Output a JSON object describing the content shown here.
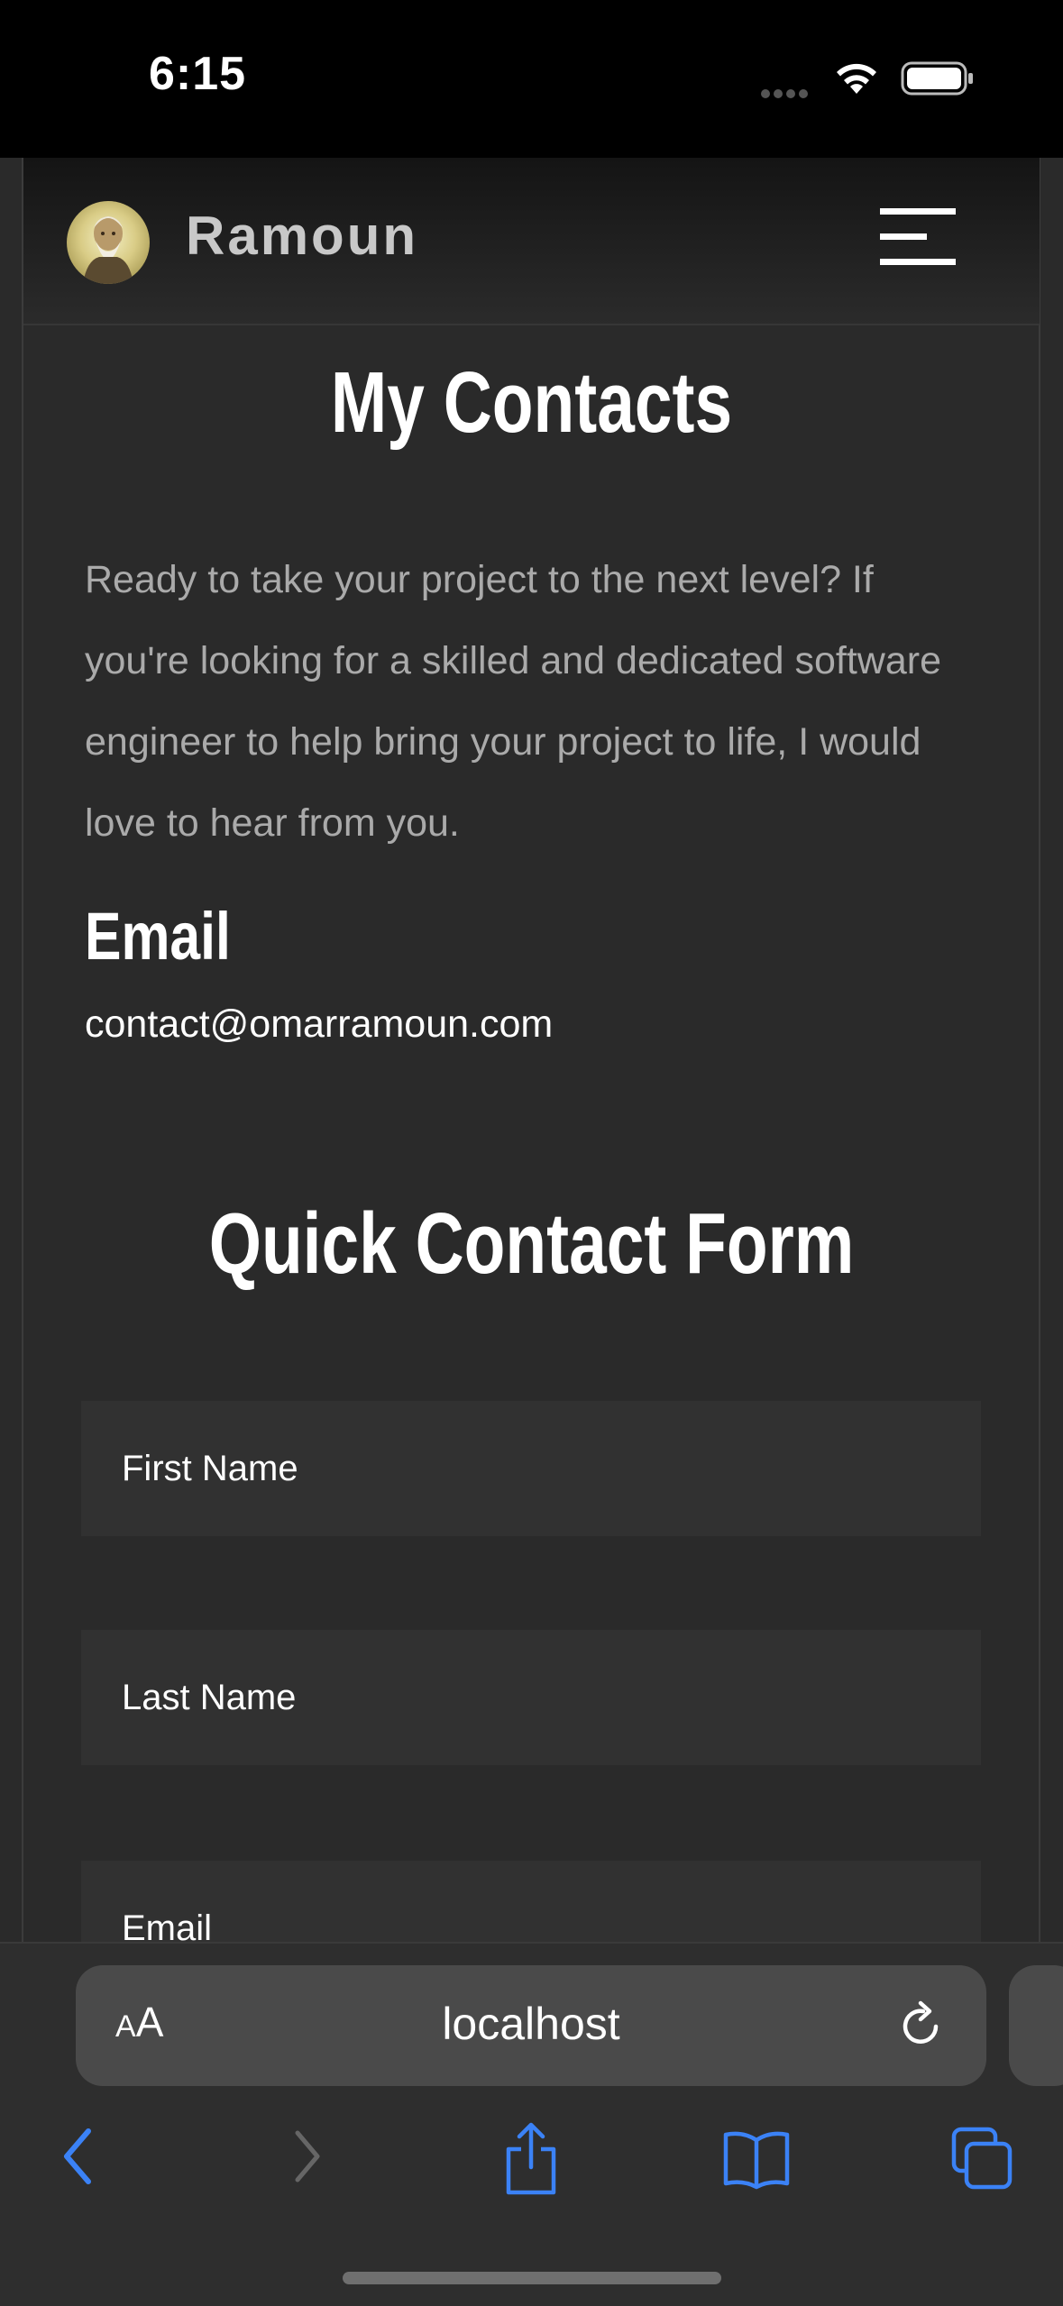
{
  "status_bar": {
    "time": "6:15"
  },
  "header": {
    "brand": "Ramoun"
  },
  "contacts": {
    "title": "My Contacts",
    "intro": "Ready to take your project to the next level? If you're looking for a skilled and dedicated software engineer to help bring your project to life, I would love to hear from you.",
    "email_heading": "Email",
    "email_value": "contact@omarramoun.com"
  },
  "form": {
    "title": "Quick Contact Form",
    "first_name_placeholder": "First Name",
    "last_name_placeholder": "Last Name",
    "email_placeholder": "Email"
  },
  "browser": {
    "text_size_small": "A",
    "text_size_big": "A",
    "url": "localhost",
    "accent_color": "#3b82f6"
  },
  "icons": [
    "wifi-icon",
    "battery-icon",
    "hamburger-menu-icon",
    "reload-icon",
    "back-icon",
    "forward-icon",
    "share-icon",
    "bookmarks-icon",
    "tabs-icon"
  ]
}
